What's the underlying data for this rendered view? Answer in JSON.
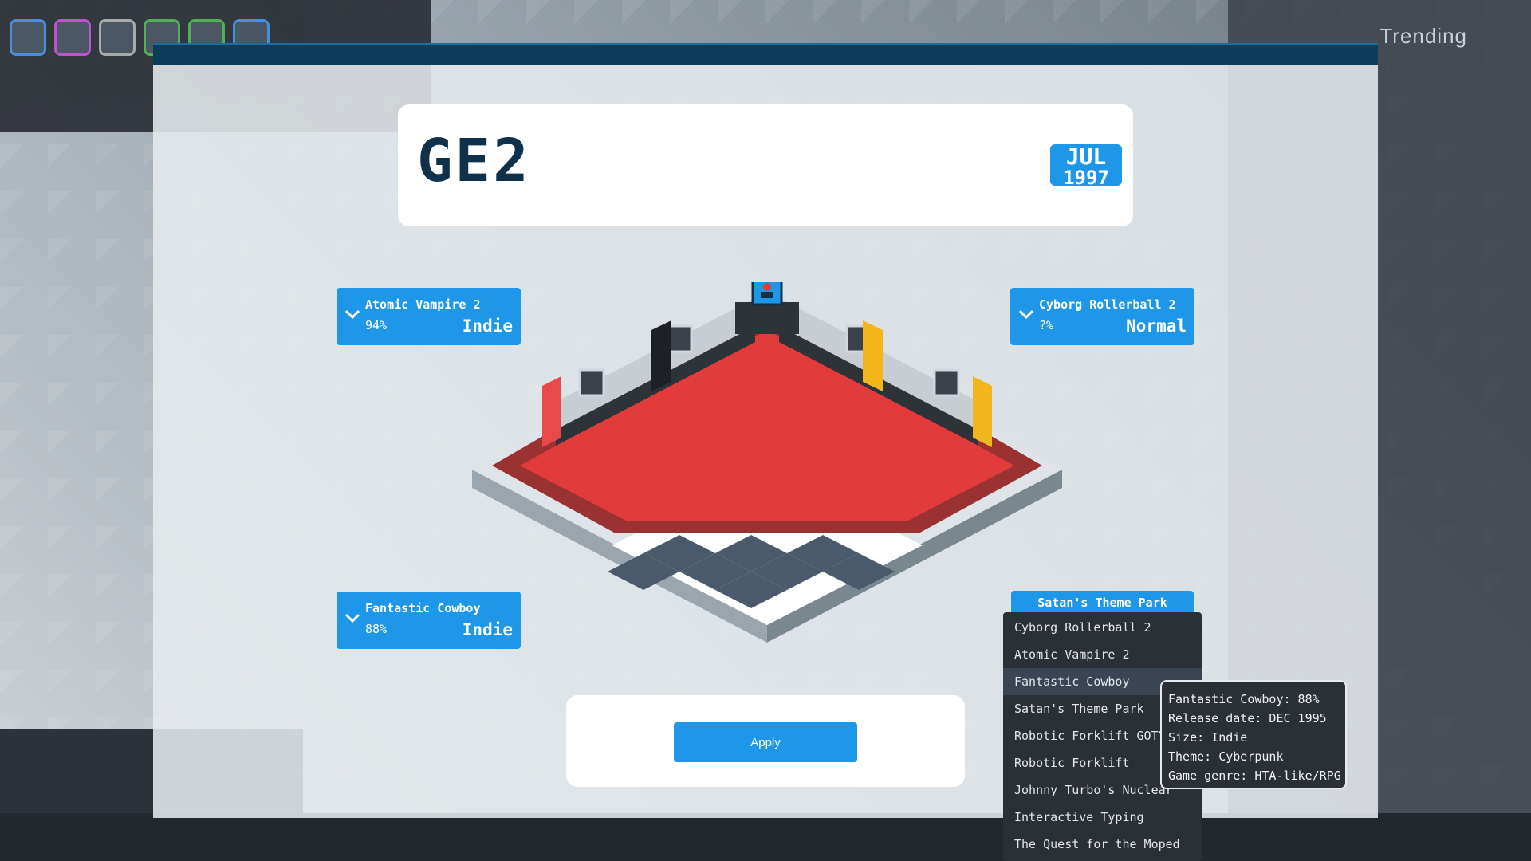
{
  "background": {
    "trending_label": "Trending"
  },
  "event": {
    "title": "GE2",
    "date_month": "JUL",
    "date_year": "1997"
  },
  "slots": [
    {
      "name": "Atomic Vampire 2",
      "percent": "94%",
      "size": "Indie"
    },
    {
      "name": "Cyborg Rollerball 2",
      "percent": "?%",
      "size": "Normal"
    },
    {
      "name": "Fantastic Cowboy",
      "percent": "88%",
      "size": "Indie"
    },
    {
      "name": "Satan's Theme Park"
    }
  ],
  "apply_label": "Apply",
  "dropdown": {
    "items": [
      "Cyborg Rollerball 2",
      "Atomic Vampire 2",
      "Fantastic Cowboy",
      "Satan's Theme Park",
      "Robotic Forklift GOTY",
      "Robotic Forklift",
      "Johnny Turbo's Nuclear",
      "Interactive Typing",
      "The Quest for the Moped"
    ],
    "highlighted": "Fantastic Cowboy"
  },
  "tooltip": {
    "line1": "Fantastic Cowboy: 88%",
    "line2": "Release date: DEC 1995",
    "line3": "Size: Indie",
    "line4": "Theme: Cyberpunk",
    "line5": "Game genre: HTA-like/RPG"
  },
  "colors": {
    "accent": "#1f97e8",
    "header_dark": "#0c3d5c",
    "title_text": "#10314c",
    "carpet_red": "#e23b3b",
    "dropdown_bg": "#2b2f36"
  }
}
